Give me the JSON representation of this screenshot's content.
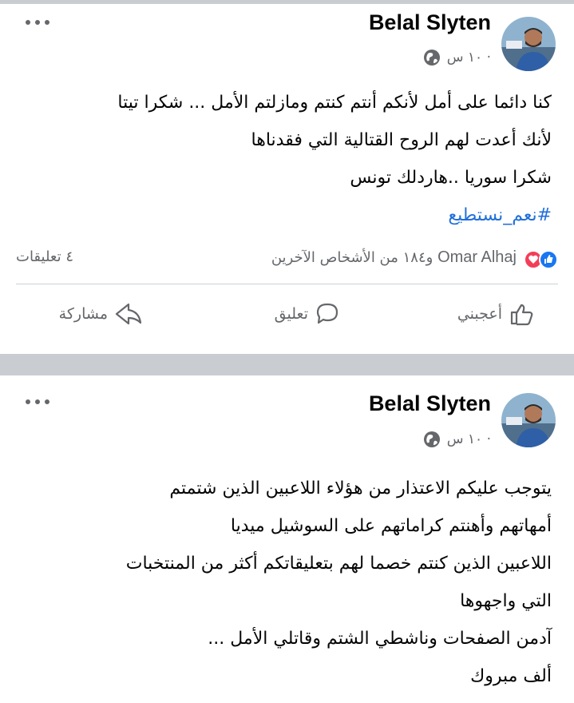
{
  "posts": [
    {
      "author": "Belal Slyten",
      "time": "١٠ س ·",
      "lines": [
        "كنا دائما على أمل لأنكم أنتم كنتم ومازلتم الأمل ... شكرا تيتا",
        "لأنك أعدت لهم الروح القتالية التي فقدناها",
        "شكرا سوريا ..هاردلك تونس"
      ],
      "hashtag": "#نعم_نستطيع",
      "reactions": {
        "name": "Omar Alhaj",
        "others": "و١٨٤ من الأشخاص الآخرين",
        "comments": "٤ تعليقات"
      },
      "actions": {
        "like": "أعجبني",
        "comment": "تعليق",
        "share": "مشاركة"
      }
    },
    {
      "author": "Belal Slyten",
      "time": "١٠ س ·",
      "lines": [
        "يتوجب عليكم الاعتذار من هؤلاء اللاعبين الذين شتمتم",
        "أمهاتهم وأهنتم كراماتهم على السوشيل ميديا",
        "اللاعبين الذين كنتم خصما لهم بتعليقاتكم أكثر من المنتخبات",
        "التي واجهوها",
        "آدمن الصفحات وناشطي الشتم وقاتلي الأمل ...",
        "ألف مبروك"
      ]
    }
  ],
  "colors": {
    "accent": "#216fdb",
    "like": "#1877f2",
    "love": "#f33e58",
    "meta": "#65676b",
    "separator": "#c9ccd1"
  },
  "icons": [
    "more-options-icon",
    "globe-icon",
    "like-reaction-icon",
    "love-reaction-icon",
    "thumbs-up-icon",
    "comment-icon",
    "share-icon"
  ]
}
